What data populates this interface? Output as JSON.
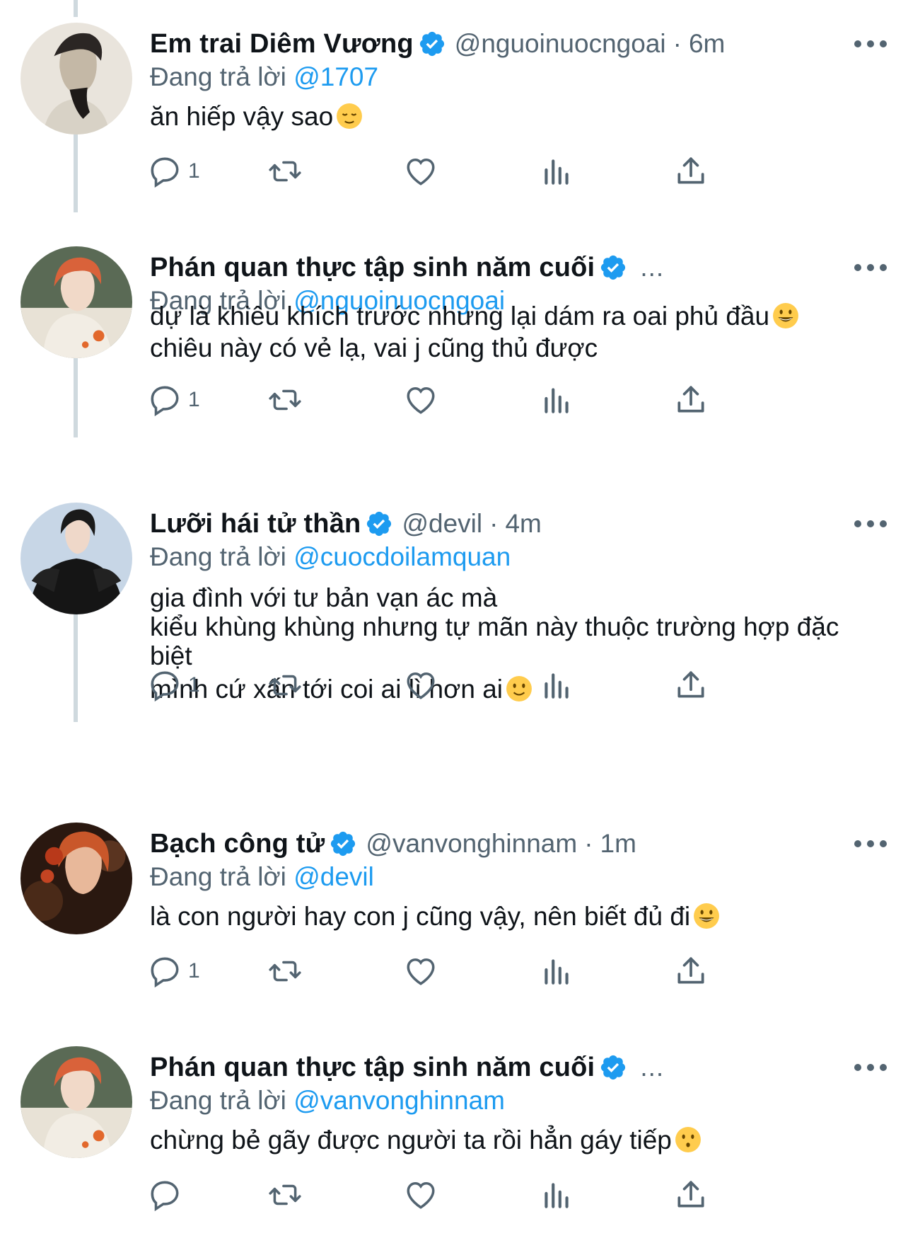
{
  "colors": {
    "text": "#0f1419",
    "secondary": "#536471",
    "accent": "#1d9bf0",
    "thread_line": "#cfd9de"
  },
  "tweets": [
    {
      "name": "Em trai Diêm Vương",
      "handle": "@nguoinuocngoai",
      "time": "6m",
      "reply_label": "Đang trả lời",
      "reply_to": "@1707",
      "lines": [
        "ăn hiếp vậy sao"
      ],
      "emoji": "relieved-face",
      "reply_count": "1"
    },
    {
      "name": "Phán quan thực tập sinh năm cuối",
      "truncated": "...",
      "reply_label": "Đang trả lời",
      "reply_to": "@nguoinuocngoai",
      "lines": [
        "dự là khiêu khích trước nhưng lại dám ra oai phủ đầu",
        "chiêu này có vẻ lạ, vai j cũng thủ được"
      ],
      "emoji": "grinning-face",
      "reply_count": "1"
    },
    {
      "name": "Lưỡi hái tử thần",
      "handle": "@devil",
      "time": "4m",
      "reply_label": "Đang trả lời",
      "reply_to": "@cuocdoilamquan",
      "lines": [
        "gia đình với tư bản vạn ác mà",
        "kiểu khùng khùng nhưng tự mãn này thuộc trường hợp đặc",
        "biệt",
        "mình cứ xấn tới coi ai lì hơn ai"
      ],
      "emoji": "slightly-smiling-face",
      "reply_count": "1"
    },
    {
      "name": "Bạch công tử",
      "handle": "@vanvonghinnam",
      "time": "1m",
      "reply_label": "Đang trả lời",
      "reply_to": "@devil",
      "lines": [
        "là con người hay con j cũng vậy, nên biết đủ đi"
      ],
      "emoji": "grinning-face",
      "reply_count": "1"
    },
    {
      "name": "Phán quan thực tập sinh năm cuối",
      "truncated": "...",
      "reply_label": "Đang trả lời",
      "reply_to": "@vanvonghinnam",
      "lines": [
        "chừng bẻ gãy được người ta rồi hẳn gáy tiếp"
      ],
      "emoji": "kissing-face"
    }
  ]
}
